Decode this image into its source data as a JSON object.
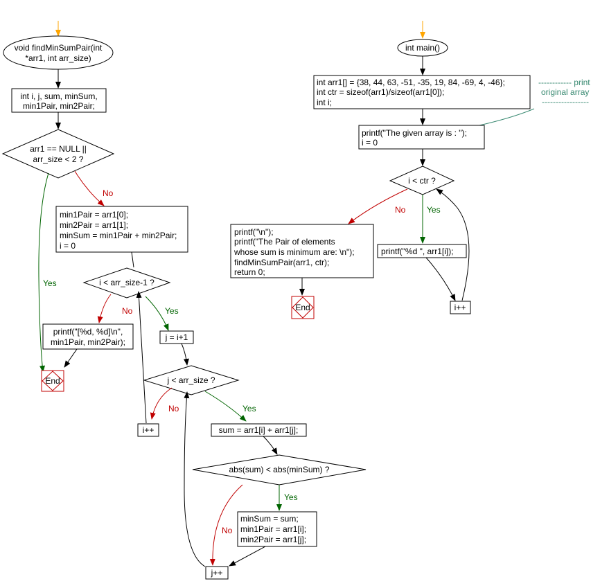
{
  "find_min_sum_pair": {
    "start": [
      "void findMinSumPair(int",
      "*arr1, int arr_size)"
    ],
    "declare": [
      "int i, j, sum, minSum,",
      "min1Pair, min2Pair;"
    ],
    "cond_null": [
      "arr1 == NULL ||",
      "arr_size < 2 ?"
    ],
    "init": [
      "min1Pair = arr1[0];",
      "min2Pair = arr1[1];",
      "minSum = min1Pair + min2Pair;",
      "i = 0"
    ],
    "cond_i": "i < arr_size-1 ?",
    "print_result": [
      "printf(\"[%d, %d]\\n\",",
      "min1Pair, min2Pair);"
    ],
    "end": "End",
    "j_init": "j = i+1",
    "cond_j": "j < arr_size ?",
    "i_inc": "i++",
    "sum": "sum = arr1[i] + arr1[j];",
    "cond_abs": "abs(sum) < abs(minSum) ?",
    "update": [
      "minSum = sum;",
      "min1Pair = arr1[i];",
      "min2Pair = arr1[j];"
    ],
    "j_inc": "j++"
  },
  "main": {
    "start": "int main()",
    "declare": [
      "int arr1[] = {38, 44, 63, -51, -35, 19, 84, -69, 4, -46};",
      "int ctr = sizeof(arr1)/sizeof(arr1[0]);",
      "int i;"
    ],
    "comment": [
      "------------ print",
      "original array",
      "-----------------"
    ],
    "print_given": [
      "printf(\"The given array is :  \");",
      "i = 0"
    ],
    "cond_i": "i < ctr ?",
    "print_elem": "printf(\"%d  \", arr1[i]);",
    "i_inc": "i++",
    "final": [
      "printf(\"\\n\");",
      "printf(\"The Pair of elements",
      "whose sum is minimum are: \\n\");",
      "findMinSumPair(arr1, ctr);",
      "return 0;"
    ],
    "end": "End"
  },
  "labels": {
    "yes": "Yes",
    "no": "No"
  },
  "colors": {
    "yes": "#006400",
    "no": "#c00000",
    "entry": "#ffa500",
    "end": "#c00000",
    "comment": "#3a8a72"
  }
}
